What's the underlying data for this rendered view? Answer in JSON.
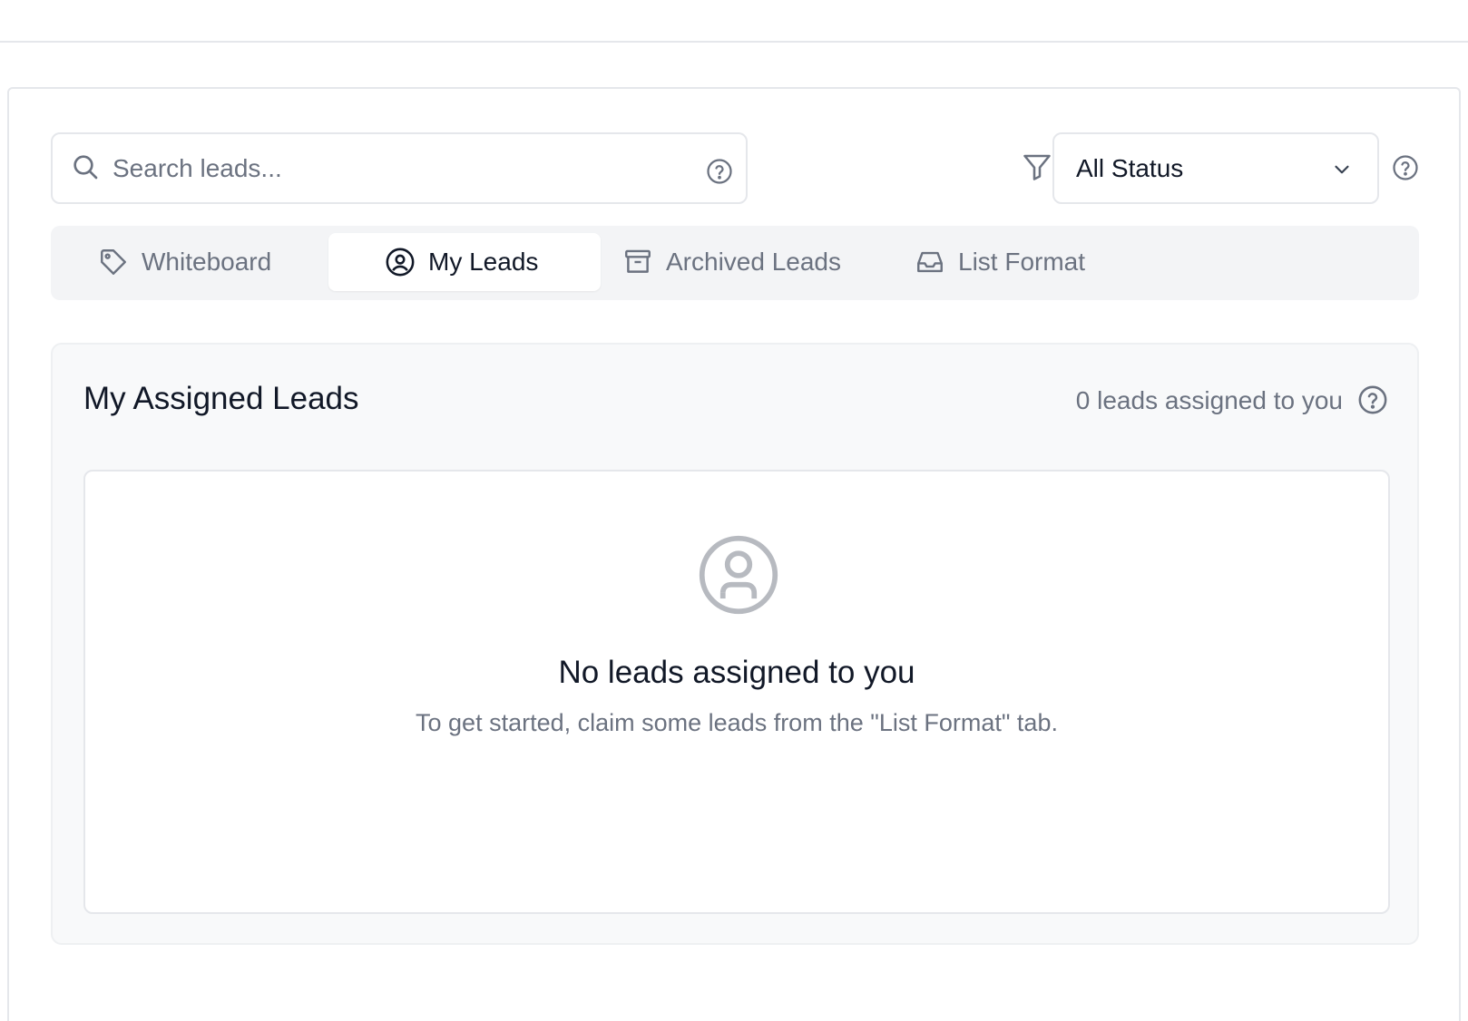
{
  "search": {
    "placeholder": "Search leads...",
    "value": ""
  },
  "status_filter": {
    "selected": "All Status"
  },
  "tabs": [
    {
      "label": "Whiteboard",
      "icon": "tag-icon",
      "active": false
    },
    {
      "label": "My Leads",
      "icon": "user-circle-icon",
      "active": true
    },
    {
      "label": "Archived Leads",
      "icon": "archive-icon",
      "active": false
    },
    {
      "label": "List Format",
      "icon": "inbox-icon",
      "active": false
    }
  ],
  "assigned": {
    "title": "My Assigned Leads",
    "count_text": "0 leads assigned to you"
  },
  "empty_state": {
    "icon": "user-circle-icon",
    "title": "No leads assigned to you",
    "subtitle": "To get started, claim some leads from the \"List Format\" tab."
  },
  "colors": {
    "text_primary": "#111827",
    "text_muted": "#6b7280",
    "border": "#e5e7eb",
    "tab_bar_bg": "#f3f4f6",
    "card_bg": "#f8f9fa",
    "icon_gray": "#b7bac0"
  }
}
